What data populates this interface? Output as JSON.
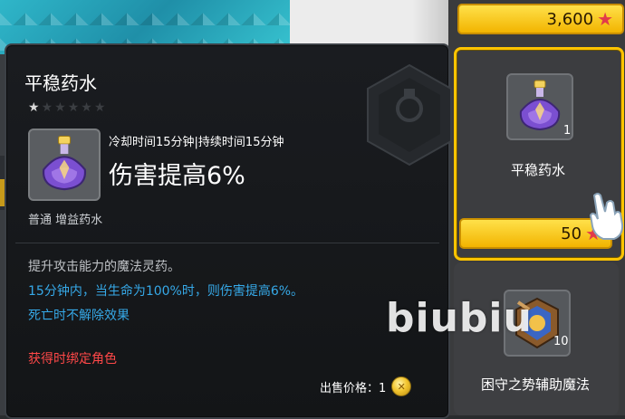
{
  "tooltip": {
    "title": "平稳药水",
    "rarity_stars": {
      "filled": 1,
      "total": 6
    },
    "cooldown_duration": "冷却时间15分钟|持续时间15分钟",
    "effect": "伤害提高6%",
    "type": "普通 增益药水",
    "description": "提升攻击能力的魔法灵药。",
    "effect_detail": "15分钟内，当生命为100%时，则伤害提高6%。",
    "death_note": "死亡时不解除效果",
    "bind_note": "获得时绑定角色",
    "sell_price": "出售价格：1",
    "icon": "purple-potion-icon",
    "colors": {
      "detail_blue": "#36a9e8",
      "bind_red": "#ff4848"
    }
  },
  "shop": {
    "top_price": "3,600",
    "items": [
      {
        "name": "平稳药水",
        "count": "1",
        "price": "50",
        "icon": "purple-potion-icon",
        "selected": true
      },
      {
        "name": "困守之势辅助魔法",
        "count": "10",
        "icon": "magic-scroll-icon",
        "selected": false
      }
    ],
    "currency_icon": "red-star-icon",
    "colors": {
      "price_bar": "#f2b400",
      "selected_border": "#ffc400"
    }
  },
  "watermark": "biubiu"
}
